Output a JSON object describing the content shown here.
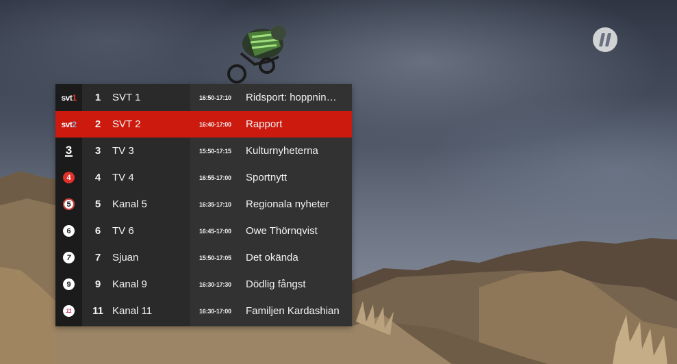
{
  "channels": [
    {
      "logo_icon": "svt1-logo-icon",
      "logo_text": "svt",
      "logo_digit": "1",
      "number": "1",
      "name": "SVT 1",
      "time": "16:50-17:10",
      "title": "Ridsport: hoppnin…",
      "selected": false
    },
    {
      "logo_icon": "svt2-logo-icon",
      "logo_text": "svt",
      "logo_digit": "2",
      "number": "2",
      "name": "SVT 2",
      "time": "16:40-17:00",
      "title": "Rapport",
      "selected": true
    },
    {
      "logo_icon": "tv3-logo-icon",
      "logo_digit": "3",
      "number": "3",
      "name": "TV 3",
      "time": "15:50-17:15",
      "title": "Kulturnyheterna",
      "selected": false
    },
    {
      "logo_icon": "tv4-logo-icon",
      "logo_digit": "4",
      "number": "4",
      "name": "TV 4",
      "time": "16:55-17:00",
      "title": "Sportnytt",
      "selected": false
    },
    {
      "logo_icon": "kanal5-logo-icon",
      "logo_digit": "5",
      "number": "5",
      "name": "Kanal 5",
      "time": "16:35-17:10",
      "title": "Regionala nyheter",
      "selected": false
    },
    {
      "logo_icon": "tv6-logo-icon",
      "logo_digit": "6",
      "number": "6",
      "name": "TV 6",
      "time": "16:45-17:00",
      "title": "Owe Thörnqvist",
      "selected": false
    },
    {
      "logo_icon": "sjuan-logo-icon",
      "logo_digit": "7",
      "number": "7",
      "name": "Sjuan",
      "time": "15:50-17:05",
      "title": "Det okända",
      "selected": false
    },
    {
      "logo_icon": "kanal9-logo-icon",
      "logo_digit": "9",
      "number": "9",
      "name": "Kanal 9",
      "time": "16:30-17:30",
      "title": "Dödlig fångst",
      "selected": false
    },
    {
      "logo_icon": "kanal11-logo-icon",
      "logo_digit": "11",
      "number": "11",
      "name": "Kanal 11",
      "time": "16:30-17:00",
      "title": "Familjen Kardashian",
      "selected": false
    }
  ],
  "colors": {
    "selected": "#cd1a0e",
    "panel": "#242424",
    "tv4_red": "#e2312b",
    "kanal11_pink": "#c2336e"
  },
  "overlay_icon": "tv-channel-watermark-icon"
}
